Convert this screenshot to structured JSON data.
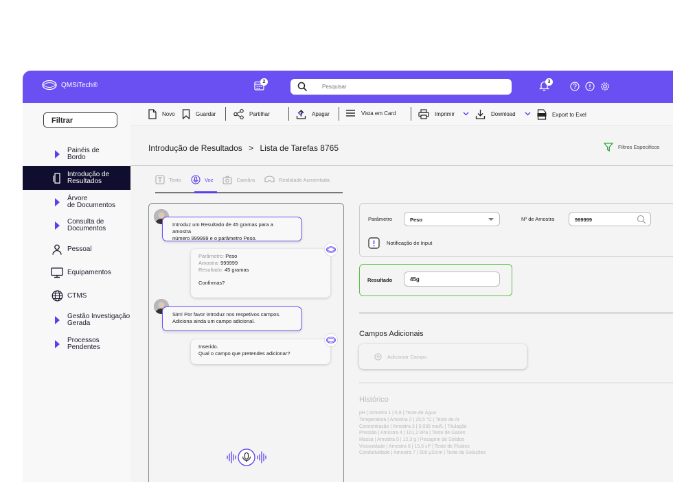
{
  "header": {
    "brand": "QMSiTech®",
    "calendar_badge": "2",
    "search_placeholder": "Pesquisar",
    "notif_badge": "3",
    "colors": {
      "topbar": "#6a4ff2",
      "accent": "#5b3ef0",
      "success": "#5cc24a"
    }
  },
  "sidebar": {
    "filter_label": "Filtrar",
    "items": [
      {
        "label1": "Painéis de",
        "label2": "Bordo",
        "icon": "triangle-icon"
      },
      {
        "label1": "Introdução de",
        "label2": "Resultados",
        "icon": "document-icon",
        "active": true
      },
      {
        "label1": "Árvore",
        "label2": "de Documentos",
        "icon": "triangle-icon"
      },
      {
        "label1": "Consulta de",
        "label2": "Documentos",
        "icon": "triangle-icon"
      },
      {
        "label1": "Pessoal",
        "label2": "",
        "icon": "person-icon"
      },
      {
        "label1": "Equipamentos",
        "label2": "",
        "icon": "monitor-icon"
      },
      {
        "label1": "CTMS",
        "label2": "",
        "icon": "globe-icon"
      },
      {
        "label1": "Gestão Investigação",
        "label2": "Gerada",
        "icon": "triangle-icon"
      },
      {
        "label1": "Processos",
        "label2": "Pendentes",
        "icon": "triangle-icon"
      }
    ]
  },
  "toolbar": {
    "novo": "Novo",
    "guardar": "Guardar",
    "partilhar": "Partilhar",
    "apagar": "Apagar",
    "vista": "Vista em Card",
    "imprimir": "Imprimir",
    "download": "Download",
    "export": "Export to Exel"
  },
  "breadcrumb": {
    "part1": "Introdução de Resultados",
    "sep": ">",
    "part2": "Lista de Tarefas 8765"
  },
  "filters_label": "Filtros Especificos",
  "tabs": [
    "Texto",
    "Voz",
    "Camâra",
    "Realidade Aumentada"
  ],
  "chat": {
    "msg1_l1": "Introduz um Resultado de 45 gramas para a amostra",
    "msg1_l2": "número 999999 e o parâmetro Peso.",
    "bot1": {
      "k1": "Parâmetro:",
      "v1": "Peso",
      "k2": "Amostra:",
      "v2": "999999",
      "k3": "Resultado:",
      "v3": "45 gramas",
      "confirm": "Confirmas?"
    },
    "msg2_l1": "Sim! Por favor introduz nos respetivos campos.",
    "msg2_l2": "Adiciona ainda um campo adicional.",
    "bot2_l1": "Inserido.",
    "bot2_l2": "Qual o campo que pretendes adicionar?"
  },
  "form": {
    "param_label": "Parâmetro",
    "param_value": "Peso",
    "amostra_label": "Nº de Amostra",
    "amostra_value": "999999",
    "notif_label": "Notificação de Input",
    "result_label": "Resultado",
    "result_value": "45g"
  },
  "campos": {
    "title": "Campos Adicionais",
    "add_label": "Adicionar Campo"
  },
  "historico": {
    "title": "Histórico",
    "lines": [
      "pH | Amostra 1 | 6,8 | Teste de Água",
      "Temperatura | Amostra 2 | 25,5 °C | Teste de Ar",
      "Concentração | Amostra 3 | 0,035 mol/L | Titulação",
      "Pressão | Amostra 4 | 101,2 kPa | Teste de Gases",
      "Massa | Amostra 5 | 12,3 g | Pesagem de Sólidos",
      "Viscosidade | Amostra 6 | 15,6 cP | Teste de Fluidos",
      "Condutividade | Amostra 7 | 500 µS/cm | Teste de Soluções"
    ]
  }
}
